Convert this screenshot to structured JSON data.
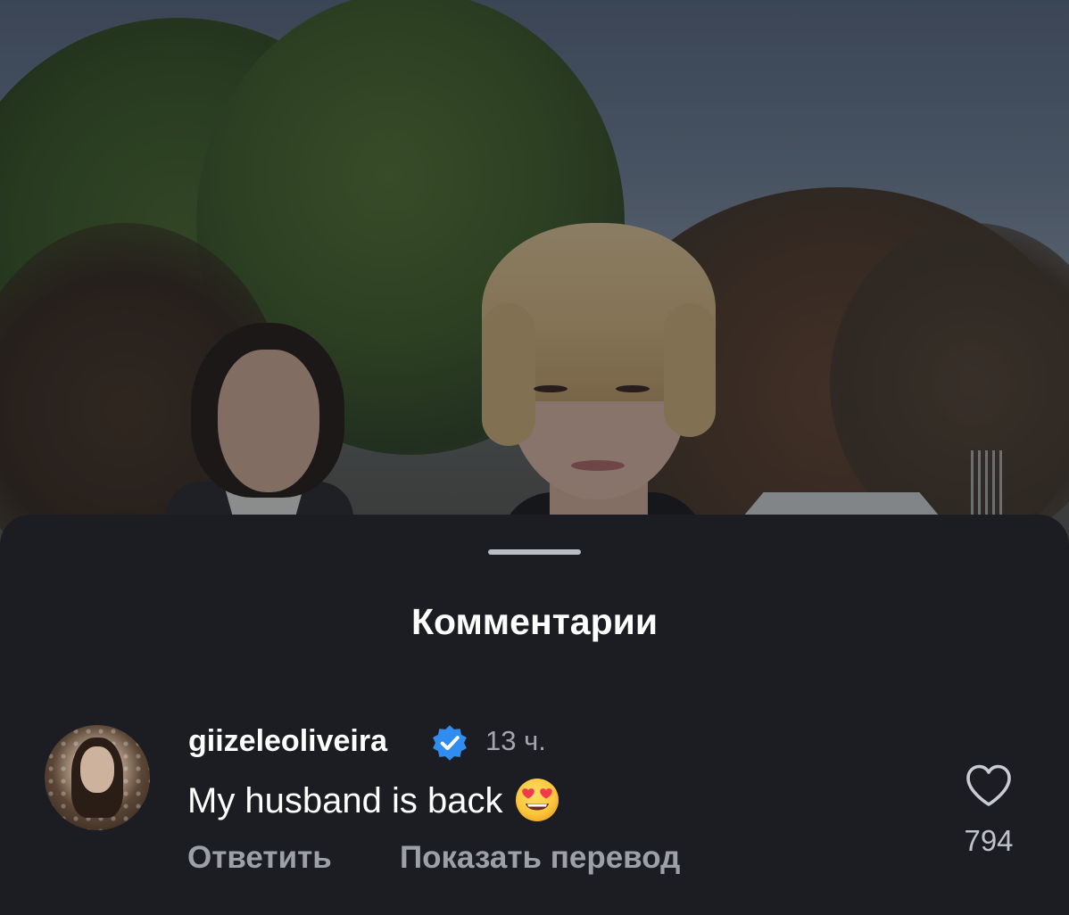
{
  "sheet": {
    "title": "Комментарии"
  },
  "comment": {
    "username": "giizeleoliveira",
    "verified": true,
    "timestamp": "13 ч.",
    "text": "My husband is back",
    "emoji": "smiling-face-with-heart-eyes",
    "reply_label": "Ответить",
    "translate_label": "Показать перевод",
    "like_count": "794"
  },
  "colors": {
    "sheet_background": "#1c1d22",
    "verified_badge": "#2f8cf0",
    "secondary_text": "#9da0a7"
  }
}
